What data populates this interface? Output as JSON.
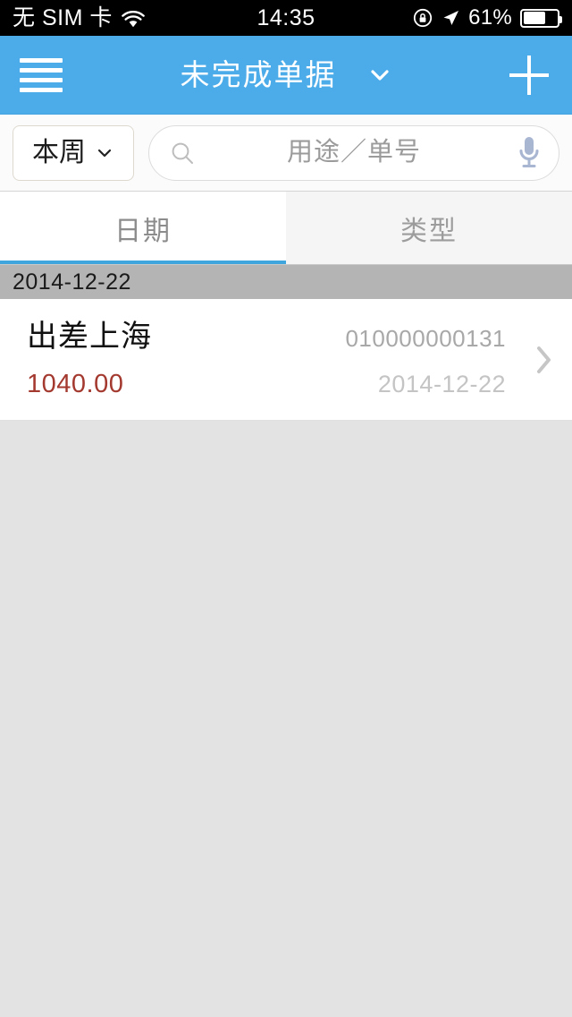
{
  "status_bar": {
    "carrier": "无 SIM 卡",
    "wifi_icon": "wifi-icon",
    "time": "14:35",
    "rotation_lock_icon": "rotation-lock-icon",
    "location_icon": "location-arrow-icon",
    "battery_percent": "61%",
    "battery_level": 61
  },
  "header": {
    "menu_icon": "hamburger-menu-icon",
    "title": "未完成单据",
    "dropdown_icon": "chevron-down-icon",
    "add_icon": "plus-icon"
  },
  "search": {
    "range_label": "本周",
    "range_dropdown_icon": "chevron-down-icon",
    "search_icon": "search-icon",
    "placeholder": "用途／单号",
    "value": "",
    "mic_icon": "microphone-icon"
  },
  "tabs": [
    {
      "label": "日期",
      "active": true
    },
    {
      "label": "类型",
      "active": false
    }
  ],
  "sections": [
    {
      "date": "2014-12-22",
      "rows": [
        {
          "title": "出差上海",
          "doc_no": "010000000131",
          "amount": "1040.00",
          "date": "2014-12-22",
          "chevron_icon": "chevron-right-icon"
        }
      ]
    }
  ],
  "colors": {
    "header_blue": "#4cace9",
    "tab_underline": "#41a5dd",
    "amount_red": "#a3392f",
    "section_header_gray": "#b4b4b4",
    "page_background": "#e3e3e3"
  }
}
